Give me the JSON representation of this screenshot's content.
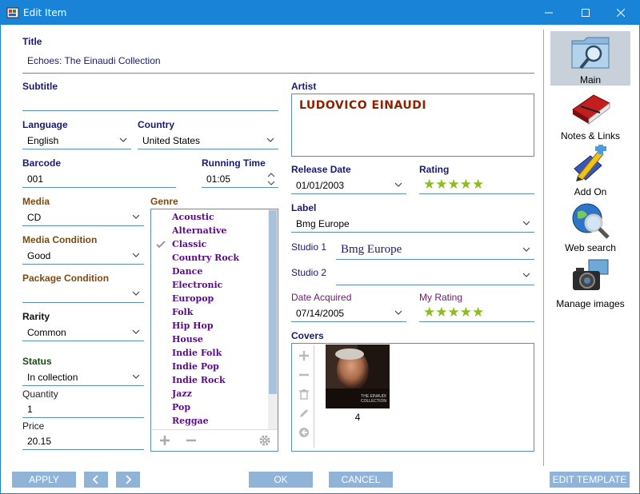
{
  "window": {
    "title": "Edit Item"
  },
  "title_field": {
    "label": "Title",
    "value": "Echoes: The Einaudi Collection"
  },
  "subtitle_field": {
    "label": "Subtitle",
    "value": ""
  },
  "artist_field": {
    "label": "Artist",
    "value": "LUDOVICO EINAUDI"
  },
  "language_field": {
    "label": "Language",
    "value": "English"
  },
  "country_field": {
    "label": "Country",
    "value": "United States"
  },
  "barcode_field": {
    "label": "Barcode",
    "value": "001"
  },
  "running_time_field": {
    "label": "Running Time",
    "value": "01:05"
  },
  "release_date_field": {
    "label": "Release Date",
    "value": "01/01/2003"
  },
  "rating_field": {
    "label": "Rating",
    "stars": 5
  },
  "media_field": {
    "label": "Media",
    "value": "CD"
  },
  "media_condition_field": {
    "label": "Media Condition",
    "value": "Good"
  },
  "package_condition_field": {
    "label": "Package Condition",
    "value": ""
  },
  "rarity_field": {
    "label": "Rarity",
    "value": "Common"
  },
  "status_field": {
    "label": "Status",
    "value": "In collection"
  },
  "quantity_field": {
    "label": "Quantity",
    "value": "1"
  },
  "price_field": {
    "label": "Price",
    "value": "20.15"
  },
  "genre": {
    "label": "Genre",
    "items": [
      "Acoustic",
      "Alternative",
      "Classic",
      "Country Rock",
      "Dance",
      "Electronic",
      "Europop",
      "Folk",
      "Hip Hop",
      "House",
      "Indie Folk",
      "Indie Pop",
      "Indie Rock",
      "Jazz",
      "Pop",
      "Reggae"
    ],
    "checked_index": 2
  },
  "label_field": {
    "label": "Label",
    "value": "Bmg Europe"
  },
  "studio1_field": {
    "label": "Studio 1",
    "value": "Bmg Europe"
  },
  "studio2_field": {
    "label": "Studio 2",
    "value": ""
  },
  "date_acquired_field": {
    "label": "Date Acquired",
    "value": "07/14/2005"
  },
  "my_rating_field": {
    "label": "My Rating",
    "stars": 5
  },
  "covers": {
    "label": "Covers",
    "count_label": "4",
    "cover_art_text": "THE EINAUDI COLLECTION"
  },
  "sidebar": {
    "items": [
      {
        "label": "Main",
        "icon": "folder-search-icon",
        "active": true
      },
      {
        "label": "Notes & Links",
        "icon": "notebook-icon",
        "active": false
      },
      {
        "label": "Add On",
        "icon": "add-on-pencil-icon",
        "active": false
      },
      {
        "label": "Web search",
        "icon": "globe-search-icon",
        "active": false
      },
      {
        "label": "Manage images",
        "icon": "camera-icon",
        "active": false
      }
    ]
  },
  "footer": {
    "apply_label": "APPLY",
    "ok_label": "OK",
    "cancel_label": "CANCEL",
    "edit_template_label": "EDIT TEMPLATE"
  },
  "colors": {
    "accent": "#1883d7",
    "button": "#8fb4d8",
    "star": "#8bbd1e",
    "genre_text": "#5b0a8a"
  }
}
